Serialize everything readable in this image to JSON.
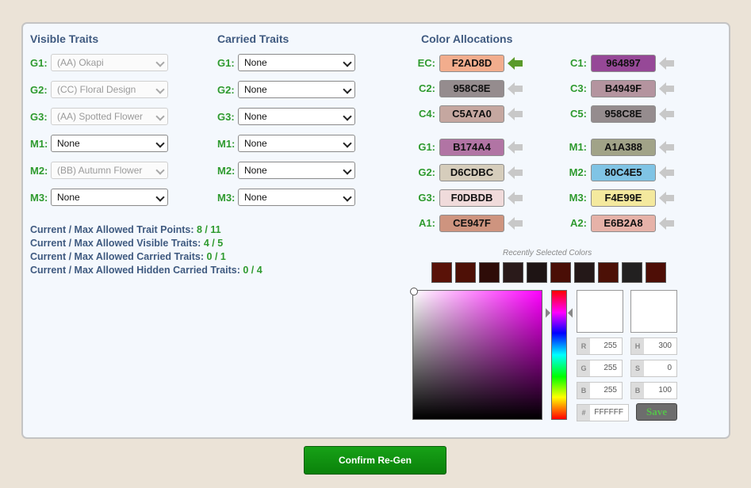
{
  "visible_traits": {
    "heading": "Visible Traits",
    "rows": [
      {
        "label": "G1:",
        "value": "(AA) Okapi",
        "disabled": true
      },
      {
        "label": "G2:",
        "value": "(CC) Floral Design",
        "disabled": true
      },
      {
        "label": "G3:",
        "value": "(AA) Spotted Flower",
        "disabled": true
      },
      {
        "label": "M1:",
        "value": "None",
        "disabled": false
      },
      {
        "label": "M2:",
        "value": "(BB) Autumn Flower",
        "disabled": true
      },
      {
        "label": "M3:",
        "value": "None",
        "disabled": false
      }
    ]
  },
  "carried_traits": {
    "heading": "Carried Traits",
    "rows": [
      {
        "label": "G1:",
        "value": "None"
      },
      {
        "label": "G2:",
        "value": "None"
      },
      {
        "label": "G3:",
        "value": "None"
      },
      {
        "label": "M1:",
        "value": "None"
      },
      {
        "label": "M2:",
        "value": "None"
      },
      {
        "label": "M3:",
        "value": "None"
      }
    ]
  },
  "stats": [
    {
      "label": "Current / Max Allowed Trait Points:",
      "value": "8 / 11"
    },
    {
      "label": "Current / Max Allowed Visible Traits:",
      "value": "4 / 5"
    },
    {
      "label": "Current / Max Allowed Carried Traits:",
      "value": "0 / 1"
    },
    {
      "label": "Current / Max Allowed Hidden Carried Traits:",
      "value": "0 / 4"
    }
  ],
  "color_allocations": {
    "heading": "Color Allocations",
    "left": [
      {
        "label": "EC:",
        "hex": "F2AD8D",
        "color": "#F2AD8D",
        "active": true
      },
      {
        "label": "C2:",
        "hex": "958C8E",
        "color": "#958C8E",
        "active": false
      },
      {
        "label": "C4:",
        "hex": "C5A7A0",
        "color": "#C5A7A0",
        "active": false
      },
      {
        "label": "G1:",
        "hex": "B174A4",
        "color": "#B174A4",
        "active": false
      },
      {
        "label": "G2:",
        "hex": "D6CDBC",
        "color": "#D6CDBC",
        "active": false
      },
      {
        "label": "G3:",
        "hex": "F0DBDB",
        "color": "#F0DBDB",
        "active": false
      },
      {
        "label": "A1:",
        "hex": "CE947F",
        "color": "#CE947F",
        "active": false
      }
    ],
    "right": [
      {
        "label": "C1:",
        "hex": "964897",
        "color": "#964897",
        "active": false
      },
      {
        "label": "C3:",
        "hex": "B4949F",
        "color": "#B4949F",
        "active": false
      },
      {
        "label": "C5:",
        "hex": "958C8E",
        "color": "#958C8E",
        "active": false
      },
      {
        "label": "M1:",
        "hex": "A1A388",
        "color": "#A1A388",
        "active": false
      },
      {
        "label": "M2:",
        "hex": "80C4E5",
        "color": "#80C4E5",
        "active": false
      },
      {
        "label": "M3:",
        "hex": "F4E99E",
        "color": "#F4E99E",
        "active": false
      },
      {
        "label": "A2:",
        "hex": "E6B2A8",
        "color": "#E6B2A8",
        "active": false
      }
    ],
    "arrow_active_color": "#5a9a2a",
    "arrow_inactive_color": "#c8c8c8"
  },
  "recent_colors": {
    "label": "Recently Selected Colors",
    "swatches": [
      "#5a1208",
      "#4e1006",
      "#2e0c08",
      "#2a1a1a",
      "#1e1414",
      "#4a0e06",
      "#241818",
      "#4c1006",
      "#222020",
      "#4e0e06"
    ]
  },
  "picker": {
    "r": "255",
    "g": "255",
    "b": "255",
    "h": "300",
    "s": "0",
    "v": "100",
    "hex": "FFFFFF",
    "tags": {
      "r": "R",
      "g": "G",
      "b": "B",
      "h": "H",
      "s": "S",
      "v": "B",
      "hex": "#"
    },
    "save_label": "Save"
  },
  "confirm_label": "Confirm Re-Gen"
}
